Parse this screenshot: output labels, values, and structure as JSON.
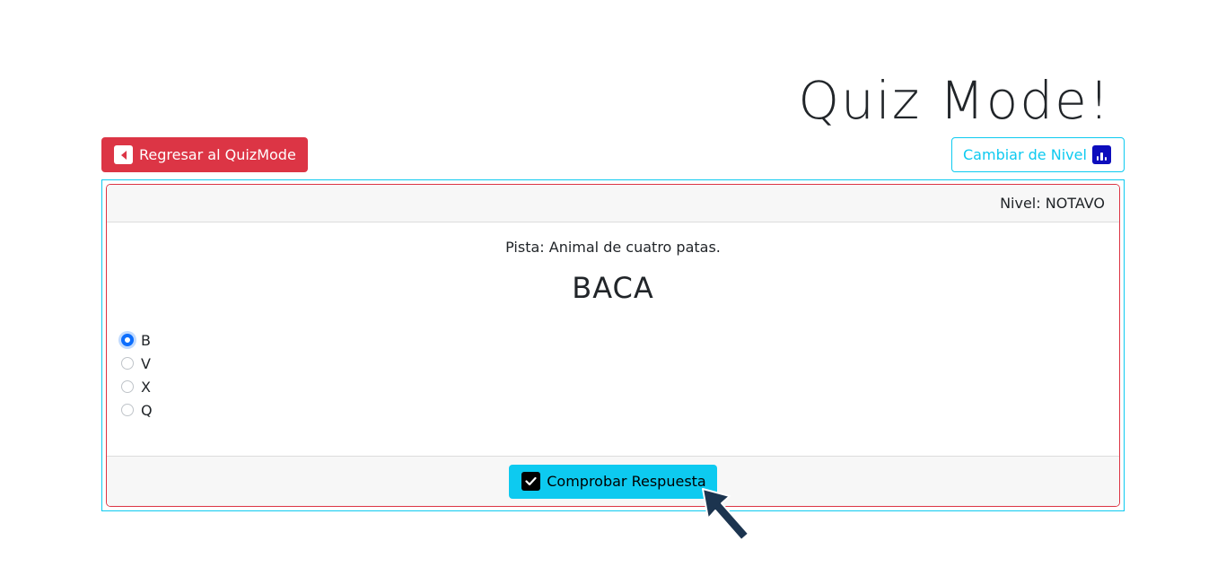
{
  "header": {
    "title": "Quiz Mode!"
  },
  "toolbar": {
    "back_label": "Regresar al QuizMode",
    "back_icon": "caret-left-icon",
    "change_level_label": "Cambiar de Nivel",
    "change_level_icon": "bar-chart-icon"
  },
  "quiz": {
    "level_text": "Nivel: NOTAVO",
    "hint": "Pista: Animal de cuatro patas.",
    "word": "BACA",
    "options": [
      {
        "label": "B",
        "checked": true
      },
      {
        "label": "V",
        "checked": false
      },
      {
        "label": "X",
        "checked": false
      },
      {
        "label": "Q",
        "checked": false
      }
    ],
    "submit_label": "Comprobar Respuesta",
    "submit_icon": "check-square-icon"
  },
  "colors": {
    "danger": "#dc3545",
    "info": "#0dcaf0",
    "primary": "#0d6efd"
  }
}
